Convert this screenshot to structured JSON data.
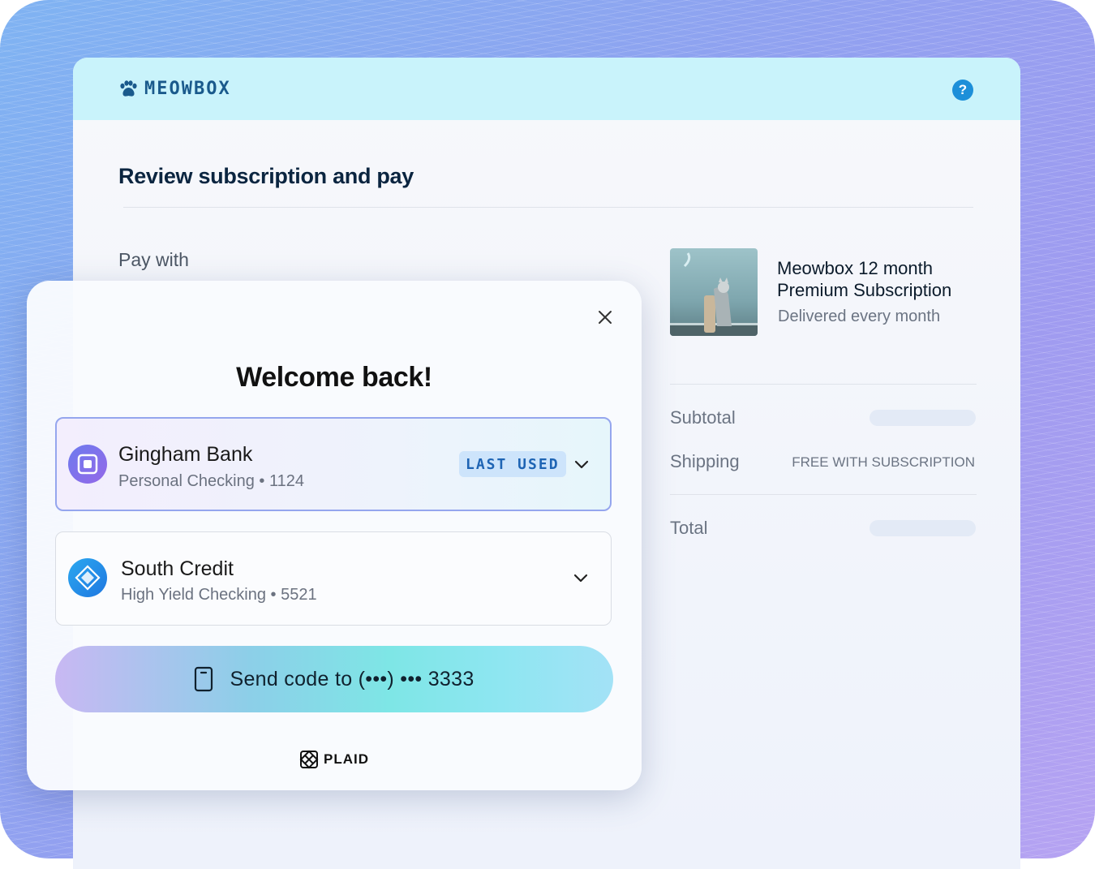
{
  "brand": {
    "name": "MEOWBOX",
    "icon": "paw-icon",
    "color": "#1a5a8c"
  },
  "header": {
    "help_label": "?"
  },
  "page": {
    "title": "Review subscription and pay",
    "pay_with": "Pay with"
  },
  "order": {
    "product_name": "Meowbox 12 month Premium Subscription",
    "product_sub": "Delivered every month",
    "subtotal_label": "Subtotal",
    "shipping_label": "Shipping",
    "shipping_value": "FREE WITH SUBSCRIPTION",
    "total_label": "Total"
  },
  "modal": {
    "title": "Welcome back!",
    "accounts": [
      {
        "bank": "Gingham Bank",
        "detail": "Personal Checking • 1124",
        "badge": "LAST USED",
        "icon": "gingham-bank-icon",
        "selected": true
      },
      {
        "bank": "South Credit",
        "detail": "High Yield Checking • 5521",
        "icon": "south-credit-icon",
        "selected": false
      }
    ],
    "send_button": "Send code to (•••) ••• 3333",
    "footer_brand": "PLAID"
  },
  "colors": {
    "accent": "#1d8fd9",
    "header_bg": "#c9f3fb",
    "selected_border": "#95a6ee"
  }
}
